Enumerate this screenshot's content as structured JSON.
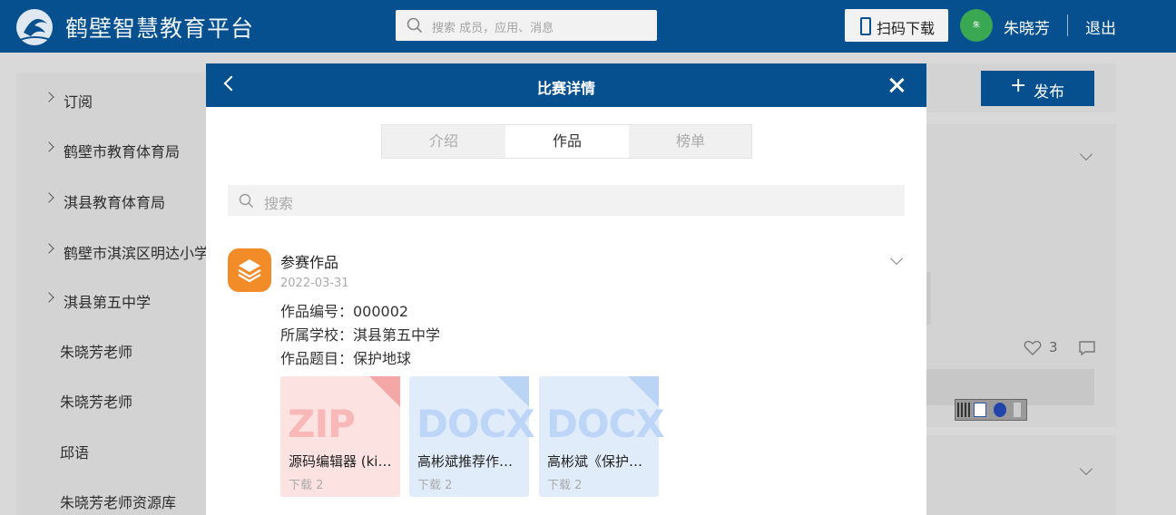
{
  "header": {
    "brand": "鹤壁智慧教育平台",
    "search_placeholder": "搜索 成员，应用、消息",
    "scan_download": "扫码下载",
    "username": "朱晓芳",
    "logout": "退出"
  },
  "sidebar": {
    "items": [
      {
        "label": "订阅"
      },
      {
        "label": "鹤壁市教育体育局"
      },
      {
        "label": "淇县教育体育局"
      },
      {
        "label": "鹤壁市淇滨区明达小学"
      },
      {
        "label": "淇县第五中学"
      }
    ],
    "subitems": [
      {
        "label": "朱晓芳老师"
      },
      {
        "label": "朱晓芳老师"
      },
      {
        "label": "邱语"
      },
      {
        "label": "朱晓芳老师资源库"
      }
    ]
  },
  "background": {
    "publish_label": "发布",
    "like_count": "3"
  },
  "modal": {
    "title": "比赛详情",
    "tabs": [
      {
        "label": "介绍",
        "active": false
      },
      {
        "label": "作品",
        "active": true
      },
      {
        "label": "榜单",
        "active": false
      }
    ],
    "search_placeholder": "搜索",
    "entry": {
      "title": "参赛作品",
      "date": "2022-03-31",
      "number": "作品编号：000002",
      "school": "所属学校：淇县第五中学",
      "topic": "作品题目：保护地球"
    },
    "files": [
      {
        "ext": "ZIP",
        "name": "源码编辑器 (kitten)",
        "downloads": "下载 2"
      },
      {
        "ext": "DOCX",
        "name": "高彬斌推荐作品说明",
        "downloads": "下载 2"
      },
      {
        "ext": "DOCX",
        "name": "高彬斌《保护地球》",
        "downloads": "下载 2"
      }
    ]
  },
  "colors": {
    "primary": "#07508f",
    "orange": "#f28c28",
    "avatar_green": "#3aa853"
  }
}
